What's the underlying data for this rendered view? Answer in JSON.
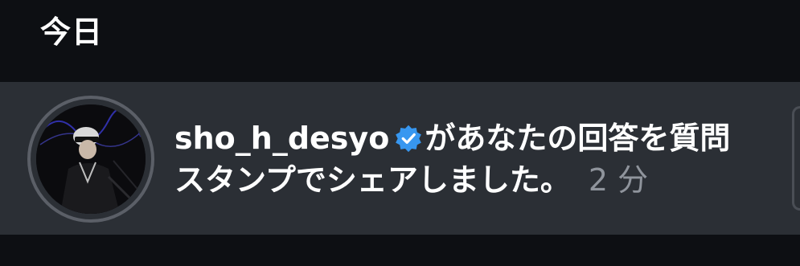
{
  "section": {
    "title": "今日"
  },
  "notification": {
    "username": "sho_h_desyo",
    "verified_icon": "verified-badge-icon",
    "message_line1": "があなたの回答を質問",
    "message_line2": "スタンプでシェアしました。",
    "time": "2 分"
  },
  "colors": {
    "background": "#0d0f13",
    "row_background": "#2b2f35",
    "verified_blue": "#3797f0",
    "time_gray": "#8f949c"
  }
}
